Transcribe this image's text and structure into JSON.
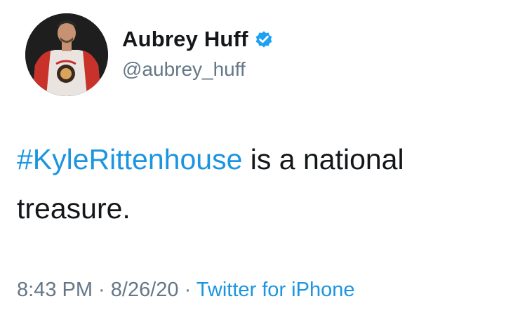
{
  "tweet": {
    "author": {
      "display_name": "Aubrey Huff",
      "handle": "@aubrey_huff",
      "verified": true,
      "avatar_icon": "profile-photo"
    },
    "text": {
      "hashtag": "#KyleRittenhouse",
      "rest_line1": " is a national",
      "rest_line2": "treasure."
    },
    "meta": {
      "time": "8:43 PM",
      "separator": " · ",
      "date": "8/26/20",
      "source": "Twitter for iPhone"
    }
  },
  "colors": {
    "link": "#1b95e0",
    "secondary_text": "#657786",
    "primary_text": "#14171a",
    "verified_badge": "#1da1f2"
  }
}
